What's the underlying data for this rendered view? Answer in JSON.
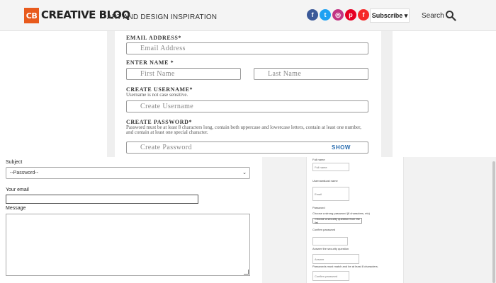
{
  "header": {
    "logo_mark": "CB",
    "logo_text": "CREATIVE BLOQ",
    "tagline": "ART AND DESIGN INSPIRATION",
    "social": [
      {
        "name": "facebook-icon",
        "glyph": "f",
        "color": "#3b5998"
      },
      {
        "name": "twitter-icon",
        "glyph": "t",
        "color": "#1da1f2"
      },
      {
        "name": "instagram-icon",
        "glyph": "◎",
        "color": "#c13584"
      },
      {
        "name": "pinterest-icon",
        "glyph": "p",
        "color": "#e60023"
      },
      {
        "name": "flipboard-icon",
        "glyph": "f",
        "color": "#f52828"
      }
    ],
    "subscribe_label": "Subscribe ▾",
    "search_label": "Search"
  },
  "signup": {
    "email_label": "EMAIL ADDRESS",
    "email_placeholder": "Email Address",
    "name_label": "ENTER NAME",
    "first_name_placeholder": "First Name",
    "last_name_placeholder": "Last Name",
    "username_label": "CREATE USERNAME",
    "username_hint": "Username is not case sensitive.",
    "username_placeholder": "Create Username",
    "password_label": "CREATE PASSWORD",
    "password_hint": "Password must be at least 8 characters long, contain both uppercase and lowercase letters, contain at least one number, and contain at least one special character.",
    "password_placeholder": "Create Password",
    "show_label": "SHOW",
    "required_mark": "*"
  },
  "contact": {
    "subject_label": "Subject",
    "subject_value": "--Password--",
    "email_label": "Your email",
    "message_label": "Message"
  },
  "mini_form": {
    "labels": [
      "Full name",
      "Full name",
      "Username",
      "Last name",
      "Email"
    ],
    "email_hint": "Password",
    "email_hint2": "Choose a strong password (8 characters, etc)",
    "select_value": "Choose a security question from the list",
    "confirm_label": "Confirm password",
    "confirm_hint": "Answer the security question",
    "answer_label": "Answer",
    "answer_hint": "Passwords must match and be at least 8 characters.",
    "confirm_placeholder": "Confirm password"
  }
}
